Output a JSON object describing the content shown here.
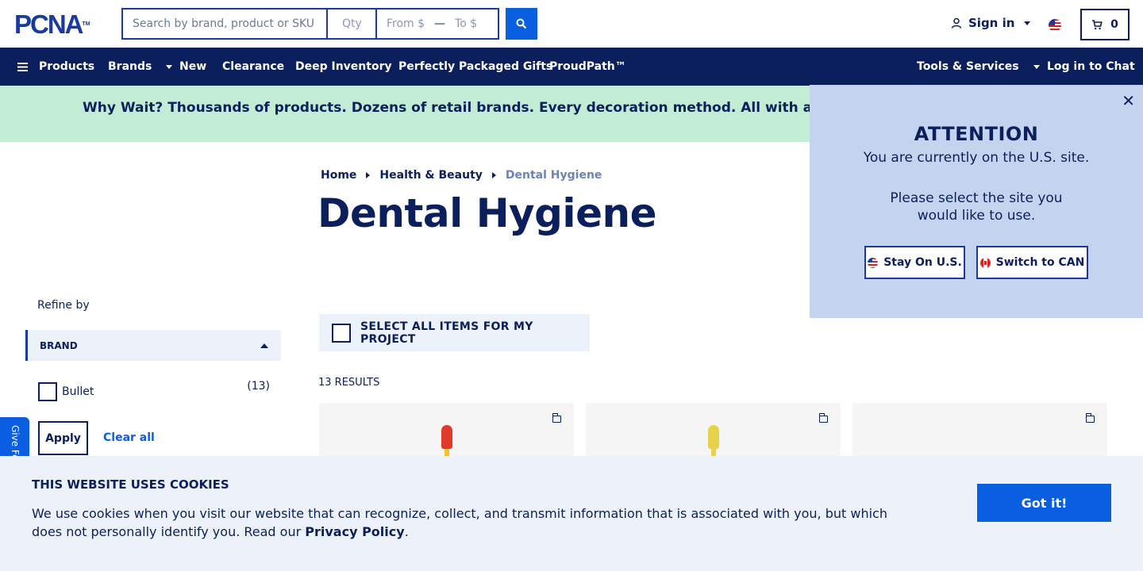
{
  "header": {
    "logo_text": "PCNA",
    "logo_tm": "TM",
    "search_placeholder": "Search by brand, product or SKU",
    "qty_placeholder": "Qty",
    "price_from_placeholder": "From $",
    "price_to_placeholder": "To $",
    "sign_in_label": "Sign in",
    "cart_count": "0"
  },
  "nav": {
    "items": [
      {
        "label": "Products"
      },
      {
        "label": "Brands"
      },
      {
        "label": "New"
      },
      {
        "label": "Clearance"
      },
      {
        "label": "Deep Inventory"
      },
      {
        "label": "Perfectly Packaged Gifts"
      },
      {
        "label": "ProudPath™"
      }
    ],
    "tools_label": "Tools & Services",
    "chat_label": "Log in to Chat"
  },
  "promo": {
    "text": "Why Wait? Thousands of products. Dozens of retail brands. Every decoration method. All with a standard"
  },
  "breadcrumb": {
    "items": [
      "Home",
      "Health & Beauty"
    ],
    "current": "Dental Hygiene"
  },
  "page_title": "Dental Hygiene",
  "sidebar": {
    "refine_label": "Refine by",
    "brand_heading": "BRAND",
    "brands": [
      {
        "label": "Bullet",
        "count": "(13)"
      }
    ],
    "apply_label": "Apply",
    "clear_label": "Clear all",
    "feedback_label": "Give Feedback"
  },
  "main": {
    "select_all_label": "SELECT ALL ITEMS FOR MY PROJECT",
    "results_label": "13 RESULTS",
    "cards": [
      {
        "brush_color": "#e03a2a",
        "neck_color": "#f2c230"
      },
      {
        "brush_color": "#e8d24a",
        "neck_color": "#e8d24a"
      },
      {
        "brush_color": "",
        "neck_color": ""
      }
    ]
  },
  "attention": {
    "title": "ATTENTION",
    "subtitle": "You are currently on the U.S. site.",
    "message": "Please select the site you would like to use.",
    "stay_label": "Stay On U.S.",
    "switch_label": "Switch to CAN"
  },
  "cookie": {
    "heading": "THIS WEBSITE USES COOKIES",
    "body": "We use cookies when you visit our website that can recognize, collect, and transmit information that is associated with you, but which does not personally identify you. Read our ",
    "link": "Privacy Policy",
    "period": ".",
    "button_label": "Got it!"
  },
  "colors": {
    "navy": "#0b1f5c",
    "brand_blue": "#1a3a9c",
    "action_blue": "#0a5ee0",
    "promo_green": "#c3ecd4",
    "popup_bg": "#c5d4ee"
  }
}
